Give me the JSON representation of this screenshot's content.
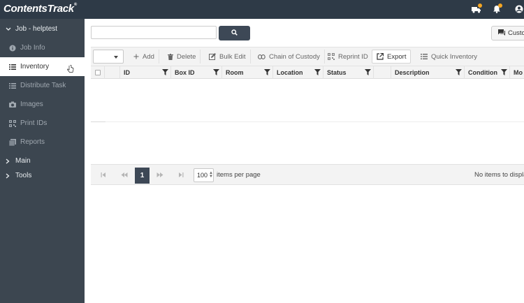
{
  "app": {
    "logo_text": "ContentsTrack",
    "logo_mark": "®"
  },
  "sidebar": {
    "job_label": "Job - helptest",
    "items": [
      {
        "label": "Job Info",
        "icon": "info-icon"
      },
      {
        "label": "Inventory",
        "icon": "list-icon",
        "active": true
      },
      {
        "label": "Distribute Task",
        "icon": "list-icon"
      },
      {
        "label": "Images",
        "icon": "camera-icon"
      },
      {
        "label": "Print IDs",
        "icon": "qrcode-icon"
      },
      {
        "label": "Reports",
        "icon": "reports-icon"
      }
    ],
    "sections": [
      {
        "label": "Main"
      },
      {
        "label": "Tools"
      }
    ]
  },
  "search": {
    "value": "",
    "placeholder": ""
  },
  "custom_button": {
    "label": "Custo"
  },
  "toolbar": {
    "add": "Add",
    "delete": "Delete",
    "bulk_edit": "Bulk Edit",
    "chain_of_custody": "Chain of Custody",
    "reprint_id": "Reprint ID",
    "export": "Export",
    "quick_inventory": "Quick Inventory"
  },
  "grid": {
    "columns": [
      "ID",
      "Box ID",
      "Room",
      "Location",
      "Status",
      "",
      "Description",
      "Condition",
      "Mo"
    ],
    "rows": []
  },
  "pager": {
    "current_page": "1",
    "per_page": "100",
    "per_page_label": "items per page",
    "no_items": "No items to display"
  },
  "colors": {
    "topbar": "#2e3a47",
    "sidebar": "#3c4650",
    "accent": "#3d4856",
    "notification": "#f5a623"
  }
}
